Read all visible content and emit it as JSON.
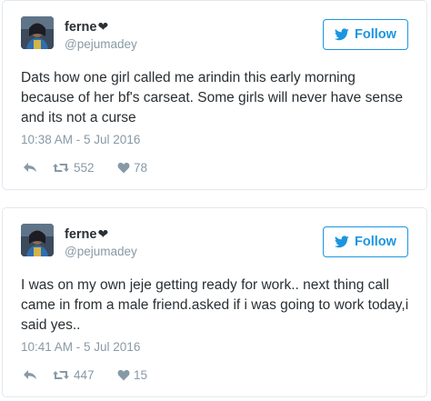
{
  "tweets": [
    {
      "name": "ferne",
      "name_symbol": "❤",
      "handle": "@pejumadey",
      "follow_label": "Follow",
      "text": "Dats how one girl called me arindin this early morning because of her bf's carseat. Some girls will never have sense and its not a curse",
      "timestamp": "10:38 AM - 5 Jul 2016",
      "retweets": "552",
      "likes": "78"
    },
    {
      "name": "ferne",
      "name_symbol": "❤",
      "handle": "@pejumadey",
      "follow_label": "Follow",
      "text": "I was on my own jeje getting ready for work.. next thing call came in from a male friend.asked if i was going to work today,i said yes..",
      "timestamp": "10:41 AM - 5 Jul 2016",
      "retweets": "447",
      "likes": "15"
    }
  ],
  "colors": {
    "accent": "#1b95e0",
    "muted": "#8899a6",
    "text": "#292f33",
    "border": "#e1e8ed"
  },
  "icons": {
    "follow": "twitter-bird-icon",
    "reply": "reply-icon",
    "retweet": "retweet-icon",
    "like": "heart-icon"
  }
}
